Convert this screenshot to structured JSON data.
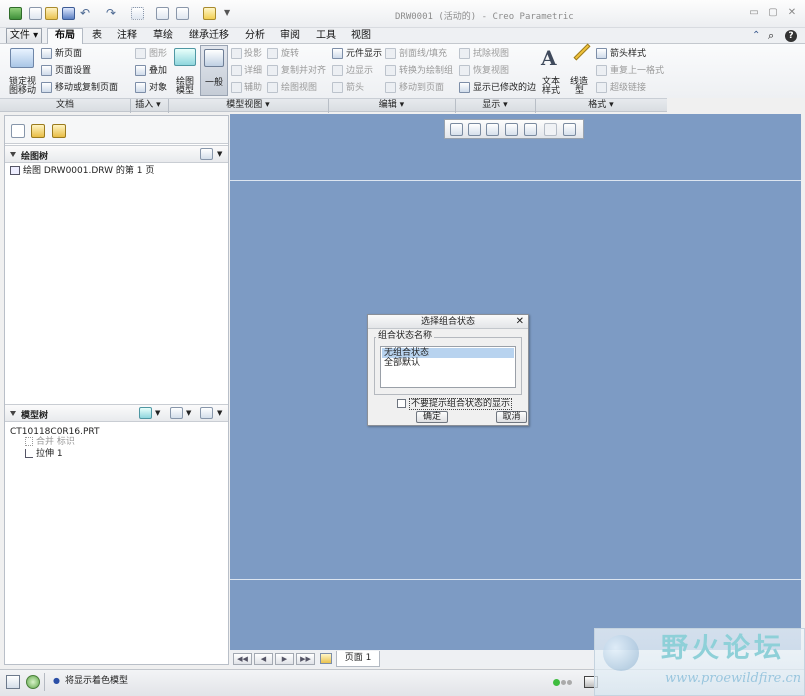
{
  "window": {
    "title": "DRW0001 (活动的) - Creo Parametric"
  },
  "tabs": [
    {
      "label": "文件",
      "kind": "file"
    },
    {
      "label": "布局",
      "active": true
    },
    {
      "label": "表"
    },
    {
      "label": "注释"
    },
    {
      "label": "草绘"
    },
    {
      "label": "继承迁移"
    },
    {
      "label": "分析"
    },
    {
      "label": "审阅"
    },
    {
      "label": "工具"
    },
    {
      "label": "视图"
    }
  ],
  "ribbon": {
    "doc": {
      "lock_label_1": "锁定视",
      "lock_label_2": "图移动",
      "new_page": "新页面",
      "page_setup": "页面设置",
      "move_copy_page": "移动或复制页面"
    },
    "insert": {
      "graphics": "图形",
      "overlay": "叠加",
      "object": "对象"
    },
    "model_views": {
      "drawing_model_1": "绘图",
      "drawing_model_2": "模型",
      "general": "一般",
      "projection": "投影",
      "detailed": "详细",
      "auxiliary": "辅助",
      "rotate": "旋转",
      "copy_align": "复制并对齐",
      "drawing_view": "绘图视图"
    },
    "edit": {
      "element_display": "元件显示",
      "edge_display": "边显示",
      "arrow": "箭头",
      "section_fill": "剖面线/填充",
      "convert_to_drawing": "转换为绘制组",
      "move_to_page": "移动到页面"
    },
    "display": {
      "erase_view": "拭除视图",
      "restore_view": "恢复视图",
      "show_modified_edges": "显示已修改的边"
    },
    "format": {
      "text_style_1": "文本",
      "text_style_2": "样式",
      "line_style_1": "线造",
      "line_style_2": "型",
      "arrow_style": "箭头样式",
      "repeat_format": "重复上一格式",
      "hyperlink": "超级链接"
    },
    "groups": [
      "文档",
      "插入",
      "模型视图",
      "编辑",
      "显示",
      "格式"
    ]
  },
  "drawing_tree": {
    "title": "绘图树",
    "items": [
      "绘图 DRW0001.DRW 的第 1 页"
    ]
  },
  "model_tree": {
    "title": "模型树",
    "items": [
      "CT10118C0R16.PRT",
      "合并 标识",
      "拉伸 1"
    ]
  },
  "dialog": {
    "title": "选择组合状态",
    "group_label": "组合状态名称",
    "options": [
      "无组合状态",
      "全部默认"
    ],
    "selected_index": 0,
    "checkbox_label": "不要提示组合状态的显示",
    "checkbox_checked": false,
    "ok": "确定",
    "cancel": "取消"
  },
  "page_nav": {
    "current_page": "页面 1"
  },
  "status": {
    "message": "将显示着色模型"
  },
  "watermark": {
    "name": "野火论坛",
    "url": "www.proewildfire.cn"
  },
  "colors": {
    "viewport_bg": "#7d9bc4",
    "selection": "#b8d3ef"
  }
}
